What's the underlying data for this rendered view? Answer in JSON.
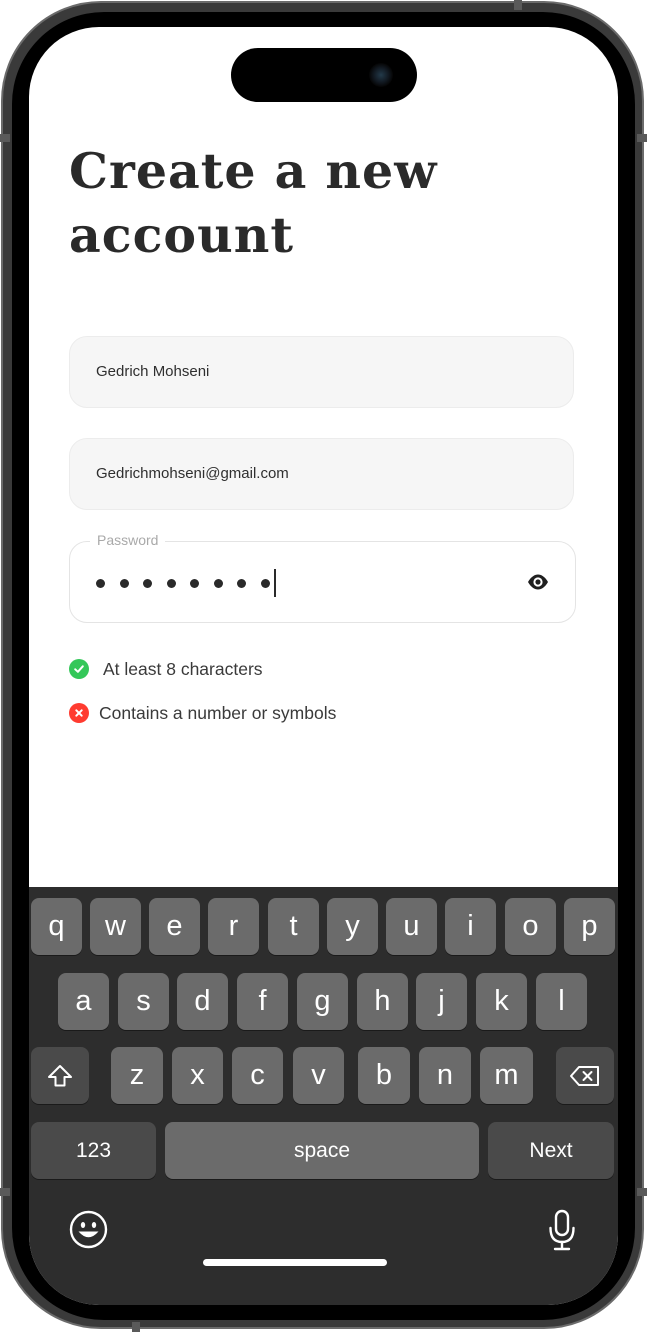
{
  "screen": {
    "title_line1": "Create a new",
    "title_line2": "account"
  },
  "form": {
    "name_value": "Gedrich Mohseni",
    "email_value": "Gedrichmohseni@gmail.com",
    "password_label": "Password",
    "password_mask_count": 8
  },
  "rules": [
    {
      "text": "At least 8 characters",
      "status": "pass",
      "color": "#34c759"
    },
    {
      "text": "Contains a number or symbols",
      "status": "fail",
      "color": "#ff3b30"
    }
  ],
  "keyboard": {
    "row1": [
      "q",
      "w",
      "e",
      "r",
      "t",
      "y",
      "u",
      "i",
      "o",
      "p"
    ],
    "row2": [
      "a",
      "s",
      "d",
      "f",
      "g",
      "h",
      "j",
      "k",
      "l"
    ],
    "row3": [
      "z",
      "x",
      "c",
      "v",
      "b",
      "n",
      "m"
    ],
    "numbers_label": "123",
    "space_label": "space",
    "next_label": "Next",
    "shift_icon": "shift-icon",
    "delete_icon": "backspace-icon",
    "emoji_icon": "emoji-icon",
    "mic_icon": "microphone-icon"
  }
}
